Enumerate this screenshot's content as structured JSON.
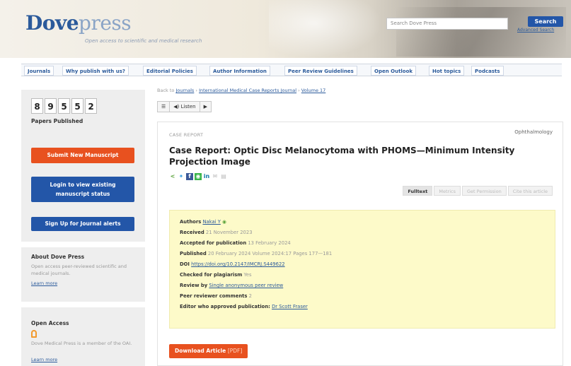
{
  "header": {
    "logo_part1": "Dove",
    "logo_part2": "press",
    "tagline": "Open access to scientific and medical research",
    "search_placeholder": "Search Dove Press",
    "search_button": "Search",
    "advanced_search": "Advanced Search"
  },
  "nav": {
    "items": [
      "Journals",
      "Why publish with us?",
      "Editorial Policies",
      "Author Information",
      "Peer Review Guidelines",
      "Open Outlook",
      "Hot topics",
      "Podcasts"
    ]
  },
  "sidebar": {
    "counter_digits": [
      "8",
      "9",
      "5",
      "5",
      "2"
    ],
    "papers_label": "Papers Published",
    "submit_button": "Submit New Manuscript",
    "login_line1": "Login to view existing",
    "login_line2": "manuscript status",
    "signup_button": "Sign Up for Journal alerts",
    "about_title": "About Dove Press",
    "about_text": "Open access peer-reviewed scientific and medical journals.",
    "about_link": "Learn more",
    "oa_title": "Open Access",
    "oa_text": "Dove Medical Press is a member of the OAI.",
    "oa_link": "Learn more"
  },
  "breadcrumb": {
    "prefix": "Back to",
    "sep": " › ",
    "journals": "Journals",
    "journal_name": "International Medical Case Reports Journal",
    "volume": "Volume 17"
  },
  "listen": {
    "menu_icon": "☰",
    "listen_label": "◀) Listen",
    "play_icon": "▶"
  },
  "article": {
    "type_tag": "CASE REPORT",
    "section": "Ophthalmology",
    "title": "Case Report: Optic Disc Melanocytoma with PHOMS—Minimum Intensity Projection Image",
    "tabs": [
      "Fulltext",
      "Metrics",
      "Get Permission",
      "Cite this article"
    ],
    "info": {
      "authors_k": "Authors",
      "authors_v": "Nakai Y",
      "received_k": "Received",
      "received_v": "21 November 2023",
      "accepted_k": "Accepted for publication",
      "accepted_v": "13 February 2024",
      "published_k": "Published",
      "published_v": "20 February 2024 Volume 2024:17 Pages 177—181",
      "doi_k": "DOI",
      "doi_v": "https://doi.org/10.2147/IMCRJ.S449622",
      "plag_k": "Checked for plagiarism",
      "plag_v": "Yes",
      "review_k": "Review by",
      "review_v": "Single anonymous peer review",
      "peer_k": "Peer reviewer comments",
      "peer_v": "2",
      "editor_k": "Editor who approved publication:",
      "editor_v": "Dr Scott Fraser"
    },
    "download_label": "Download Article",
    "download_size": "[PDF]"
  },
  "colors": {
    "accent_orange": "#e8511f",
    "accent_blue": "#2356a8",
    "info_bg": "#fdfac9"
  }
}
